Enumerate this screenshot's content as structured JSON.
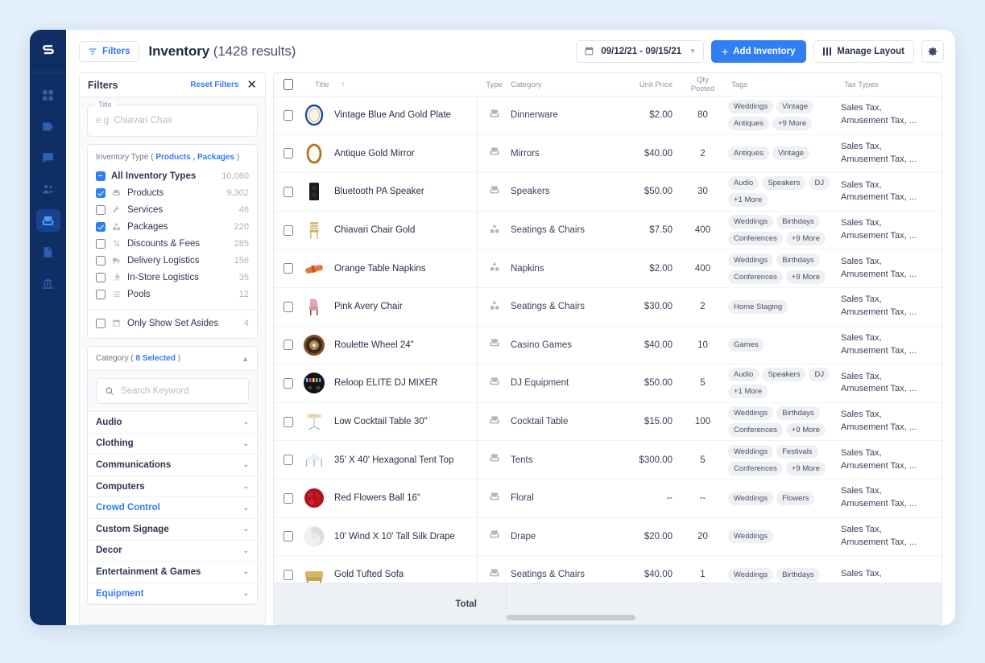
{
  "rail": {
    "logo": "shopify-s-logo",
    "items": [
      {
        "name": "dashboard-icon",
        "active": false
      },
      {
        "name": "tag-icon",
        "active": false
      },
      {
        "name": "chat-icon",
        "active": false
      },
      {
        "name": "contacts-icon",
        "active": false
      },
      {
        "name": "inventory-armchair-icon",
        "active": true
      },
      {
        "name": "documents-icon",
        "active": false
      },
      {
        "name": "bank-icon",
        "active": false
      }
    ]
  },
  "header": {
    "filters_label": "Filters",
    "title": "Inventory",
    "count": "(1428 results)",
    "date_range": "09/12/21 - 09/15/21",
    "add_label": "Add Inventory",
    "manage_layout_label": "Manage Layout",
    "settings_icon": "gear-icon"
  },
  "filters": {
    "heading": "Filters",
    "reset_label": "Reset Filters",
    "close_icon": "close-icon",
    "title_field": {
      "label": "Title",
      "placeholder": "e.g. Chiavari Chair",
      "value": ""
    },
    "inventory_type": {
      "title_prefix": "Inventory Type (",
      "title_links": "Products , Packages",
      "title_suffix": ")",
      "items": [
        {
          "label": "All Inventory Types",
          "count": "10,060",
          "state": "indeterminate",
          "icon": ""
        },
        {
          "label": "Products",
          "count": "9,302",
          "state": "checked",
          "icon": "armchair-icon"
        },
        {
          "label": "Services",
          "count": "46",
          "state": "unchecked",
          "icon": "wrench-icon"
        },
        {
          "label": "Packages",
          "count": "220",
          "state": "checked",
          "icon": "shapes-icon"
        },
        {
          "label": "Discounts & Fees",
          "count": "285",
          "state": "unchecked",
          "icon": "discount-icon"
        },
        {
          "label": "Delivery Logistics",
          "count": "156",
          "state": "unchecked",
          "icon": "truck-icon"
        },
        {
          "label": "In-Store Logistics",
          "count": "35",
          "state": "unchecked",
          "icon": "walker-icon"
        },
        {
          "label": "Pools",
          "count": "12",
          "state": "unchecked",
          "icon": "list-icon"
        }
      ],
      "set_asides": {
        "label": "Only Show Set Asides",
        "count": "4",
        "state": "unchecked",
        "icon": "calendar-icon"
      }
    },
    "category": {
      "title_prefix": "Category (",
      "title_selected": "8 Selected",
      "title_suffix": ")",
      "search_placeholder": "Search Keyword",
      "search_icon": "search-icon",
      "rows": [
        {
          "label": "Audio",
          "highlighted": false
        },
        {
          "label": "Clothing",
          "highlighted": false
        },
        {
          "label": "Communications",
          "highlighted": false
        },
        {
          "label": "Computers",
          "highlighted": false
        },
        {
          "label": "Crowd Control",
          "highlighted": true
        },
        {
          "label": "Custom Signage",
          "highlighted": false
        },
        {
          "label": "Decor",
          "highlighted": false
        },
        {
          "label": "Entertainment & Games",
          "highlighted": false
        },
        {
          "label": "Equipment",
          "highlighted": true
        }
      ]
    }
  },
  "table": {
    "columns": {
      "title": "Title",
      "sort_indicator": "↑",
      "type": "Type",
      "category": "Category",
      "unit_price": "Unit Price",
      "qty_posted_line1": "Qty",
      "qty_posted_line2": "Posted",
      "tags": "Tags",
      "tax_types": "Tax Types"
    },
    "total_label": "Total",
    "rows": [
      {
        "thumb": "blue-gold-plate",
        "title": "Vintage Blue And Gold Plate",
        "type": "product",
        "category": "Dinnerware",
        "unit_price": "$2.00",
        "qty": "80",
        "tags": [
          "Weddings",
          "Vintage",
          "Antiques",
          "+9 More"
        ],
        "tax_types": "Sales Tax, Amusement Tax, ..."
      },
      {
        "thumb": "gold-mirror",
        "title": "Antique Gold Mirror",
        "type": "product",
        "category": "Mirrors",
        "unit_price": "$40.00",
        "qty": "2",
        "tags": [
          "Antiques",
          "Vintage"
        ],
        "tax_types": "Sales Tax, Amusement Tax, ..."
      },
      {
        "thumb": "pa-speaker",
        "title": "Bluetooth PA Speaker",
        "type": "product",
        "category": "Speakers",
        "unit_price": "$50.00",
        "qty": "30",
        "tags": [
          "Audio",
          "Speakers",
          "DJ",
          "+1 More"
        ],
        "tax_types": "Sales Tax, Amusement Tax, ..."
      },
      {
        "thumb": "chiavari-chair",
        "title": "Chiavari Chair Gold",
        "type": "package",
        "category": "Seatings & Chairs",
        "unit_price": "$7.50",
        "qty": "400",
        "tags": [
          "Weddings",
          "Birthdays",
          "Conferences",
          "+9 More"
        ],
        "tax_types": "Sales Tax, Amusement Tax, ..."
      },
      {
        "thumb": "orange-napkin",
        "title": "Orange Table Napkins",
        "type": "package",
        "category": "Napkins",
        "unit_price": "$2.00",
        "qty": "400",
        "tags": [
          "Weddings",
          "Birthdays",
          "Conferences",
          "+9 More"
        ],
        "tax_types": "Sales Tax, Amusement Tax, ..."
      },
      {
        "thumb": "pink-chair",
        "title": "Pink Avery Chair",
        "type": "package",
        "category": "Seatings & Chairs",
        "unit_price": "$30.00",
        "qty": "2",
        "tags": [
          "Home Staging"
        ],
        "tax_types": "Sales Tax, Amusement Tax, ..."
      },
      {
        "thumb": "roulette-wheel",
        "title": "Roulette Wheel 24\"",
        "type": "product",
        "category": "Casino Games",
        "unit_price": "$40.00",
        "qty": "10",
        "tags": [
          "Games"
        ],
        "tax_types": "Sales Tax, Amusement Tax, ..."
      },
      {
        "thumb": "dj-mixer",
        "title": "Reloop ELITE DJ MIXER",
        "type": "product",
        "category": "DJ Equipment",
        "unit_price": "$50.00",
        "qty": "5",
        "tags": [
          "Audio",
          "Speakers",
          "DJ",
          "+1 More"
        ],
        "tax_types": "Sales Tax, Amusement Tax, ..."
      },
      {
        "thumb": "cocktail-table",
        "title": "Low Cocktail Table 30\"",
        "type": "product",
        "category": "Cocktail Table",
        "unit_price": "$15.00",
        "qty": "100",
        "tags": [
          "Weddings",
          "Birthdays",
          "Conferences",
          "+9 More"
        ],
        "tax_types": "Sales Tax, Amusement Tax, ..."
      },
      {
        "thumb": "tent-top",
        "title": "35' X 40' Hexagonal Tent Top",
        "type": "product",
        "category": "Tents",
        "unit_price": "$300.00",
        "qty": "5",
        "tags": [
          "Weddings",
          "Festivals",
          "Conferences",
          "+9 More"
        ],
        "tax_types": "Sales Tax, Amusement Tax, ..."
      },
      {
        "thumb": "red-flower-ball",
        "title": "Red Flowers Ball 16\"",
        "type": "product",
        "category": "Floral",
        "unit_price": "--",
        "qty": "--",
        "tags": [
          "Weddings",
          "Flowers"
        ],
        "tax_types": "Sales Tax, Amusement Tax, ..."
      },
      {
        "thumb": "silk-drape",
        "title": "10' Wind X 10' Tall Silk Drape",
        "type": "product",
        "category": "Drape",
        "unit_price": "$20.00",
        "qty": "20",
        "tags": [
          "Weddings"
        ],
        "tax_types": "Sales Tax, Amusement Tax, ..."
      },
      {
        "thumb": "gold-sofa",
        "title": "Gold Tufted Sofa",
        "type": "product",
        "category": "Seatings & Chairs",
        "unit_price": "$40.00",
        "qty": "1",
        "tags": [
          "Weddings",
          "Birthdays"
        ],
        "tax_types": "Sales Tax,"
      }
    ]
  },
  "colors": {
    "accent": "#2f7ef2",
    "sidebar": "#0f2e63",
    "page_bg": "#e4f0fb",
    "link": "#3478f6"
  }
}
